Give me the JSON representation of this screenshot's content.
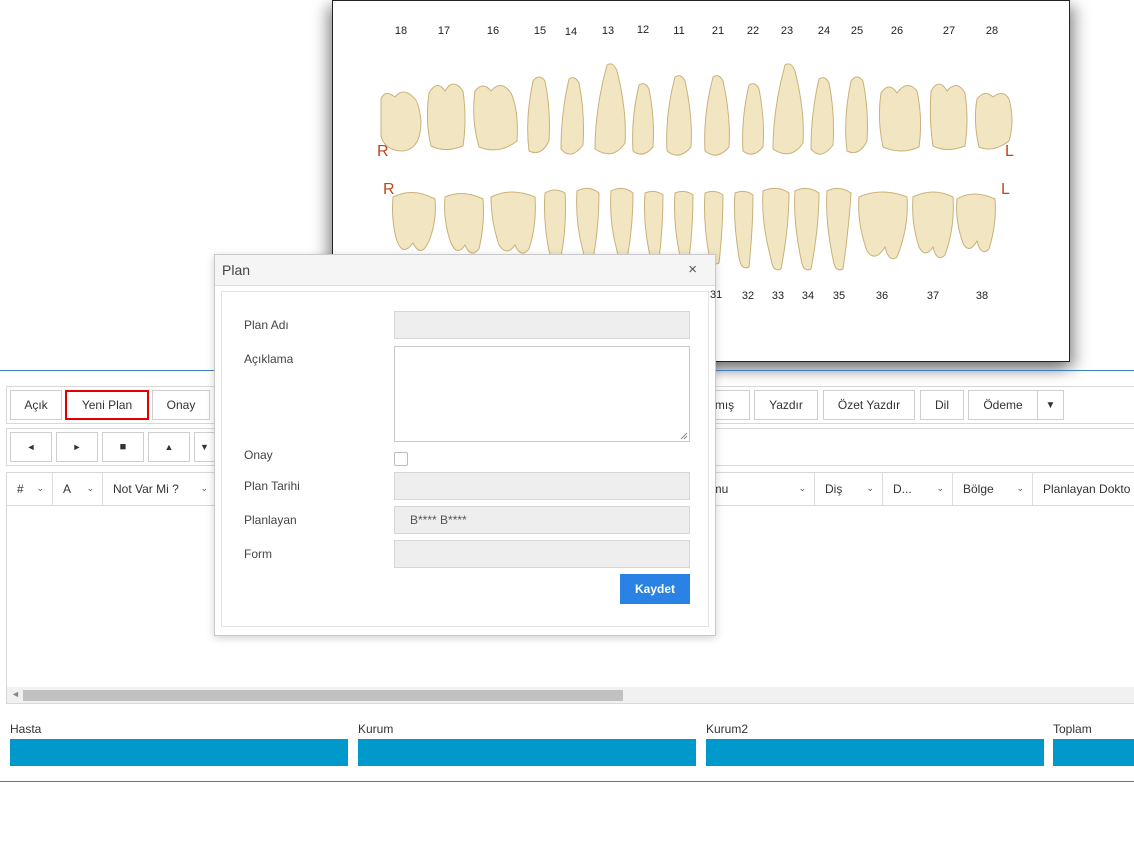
{
  "chart": {
    "upper_numbers": [
      "18",
      "17",
      "16",
      "15",
      "14",
      "13",
      "12",
      "11",
      "21",
      "22",
      "23",
      "24",
      "25",
      "26",
      "27",
      "28"
    ],
    "lower_numbers": [
      "31",
      "32",
      "33",
      "34",
      "35",
      "36",
      "37",
      "38"
    ],
    "side_left_upper": "R",
    "side_left_lower": "R",
    "side_right_upper": "L",
    "side_right_lower": "L"
  },
  "toolbar": {
    "buttons": [
      "Açık",
      "Yeni Plan",
      "Onay",
      "mış",
      "Yazdır",
      "Özet Yazdır",
      "Dil",
      "Ödeme"
    ],
    "dropdown_icon": "▼"
  },
  "nav": {
    "prev": "◄",
    "next": "►",
    "note": "■",
    "up": "▲",
    "down": "▼"
  },
  "grid": {
    "columns": [
      "#",
      "A",
      "Not Var Mi ?",
      "umu",
      "Diş",
      "D...",
      "Bölge",
      "Planlayan Dokto"
    ],
    "chevron": "⌄",
    "scroll_left": "◄"
  },
  "footer": {
    "labels": [
      "Hasta",
      "Kurum",
      "Kurum2",
      "Toplam"
    ]
  },
  "dialog": {
    "title": "Plan",
    "close": "×",
    "labels": {
      "plan_adi": "Plan Adı",
      "aciklama": "Açıklama",
      "onay": "Onay",
      "plan_tarihi": "Plan Tarihi",
      "planlayan": "Planlayan",
      "form": "Form"
    },
    "values": {
      "plan_adi": "",
      "plan_tarihi": "",
      "planlayan": "B**** B****",
      "form": ""
    },
    "save_label": "Kaydet"
  },
  "colors": {
    "accent": "#2a82e4",
    "footer_bar": "#0099cc",
    "highlight": "#e00000",
    "line": "#3c7fc4"
  }
}
